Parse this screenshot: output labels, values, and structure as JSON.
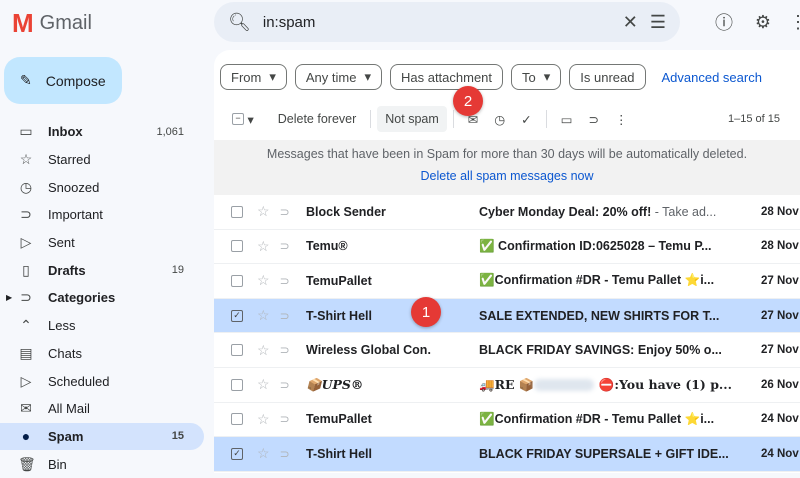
{
  "app": {
    "name": "Gmail",
    "logo_letter": "M"
  },
  "search": {
    "value": "in:spam"
  },
  "compose_label": "Compose",
  "sidebar": [
    {
      "label": "Inbox",
      "count": "1,061",
      "icon": "inbox-icon",
      "glyph": "▭",
      "bold": true
    },
    {
      "label": "Starred",
      "icon": "star-icon",
      "glyph": "☆"
    },
    {
      "label": "Snoozed",
      "icon": "clock-icon",
      "glyph": "◷"
    },
    {
      "label": "Important",
      "icon": "important-icon",
      "glyph": "⊃"
    },
    {
      "label": "Sent",
      "icon": "send-icon",
      "glyph": "▷"
    },
    {
      "label": "Drafts",
      "count": "19",
      "icon": "draft-icon",
      "glyph": "▯",
      "bold": true
    },
    {
      "label": "Categories",
      "icon": "label-icon",
      "glyph": "⊃",
      "bold": true
    },
    {
      "label": "Less",
      "icon": "chevron-up-icon",
      "glyph": "⌃"
    },
    {
      "label": "Chats",
      "icon": "chat-icon",
      "glyph": "▤"
    },
    {
      "label": "Scheduled",
      "icon": "scheduled-icon",
      "glyph": "▷"
    },
    {
      "label": "All Mail",
      "icon": "all-mail-icon",
      "glyph": "✉"
    },
    {
      "label": "Spam",
      "count": "15",
      "icon": "spam-icon",
      "glyph": "●",
      "active": true
    },
    {
      "label": "Bin",
      "icon": "trash-icon",
      "glyph": "🗑"
    }
  ],
  "filters": {
    "from": "From",
    "any_time": "Any time",
    "has_attachment": "Has attachment",
    "to": "To",
    "is_unread": "Is unread",
    "advanced": "Advanced search"
  },
  "toolbar": {
    "delete_forever": "Delete forever",
    "not_spam": "Not spam",
    "pagination": "1–15 of 15"
  },
  "banner": {
    "message": "Messages that have been in Spam for more than 30 days will be automatically deleted.",
    "link": "Delete all spam messages now"
  },
  "emails": [
    {
      "sender": "Block Sender",
      "subject": "Cyber Monday Deal: 20% off!",
      "snippet": " - Take ad...",
      "date": "28 Nov",
      "selected": false
    },
    {
      "sender": "Temu®",
      "subject": "✅ Confirmation ID:0625028 – Temu P...",
      "snippet": "",
      "date": "28 Nov",
      "selected": false
    },
    {
      "sender": "TemuPallet",
      "subject": "✅Confirmation #DR - Temu Pallet ⭐i...",
      "snippet": "",
      "date": "27 Nov",
      "selected": false
    },
    {
      "sender": "T-Shirt Hell",
      "subject": "SALE EXTENDED, NEW SHIRTS FOR T...",
      "snippet": "",
      "date": "27 Nov",
      "selected": true
    },
    {
      "sender": "Wireless Global Con.",
      "subject": "BLACK FRIDAY SAVINGS: Enjoy 50% o...",
      "snippet": "",
      "date": "27 Nov",
      "selected": false
    },
    {
      "sender": "📦UPS®",
      "subject": "🚚RE 📦",
      "subject_tail": "⛔:You have (1) p...",
      "snippet": "",
      "date": "26 Nov",
      "selected": false
    },
    {
      "sender": "TemuPallet",
      "subject": "✅Confirmation #DR - Temu Pallet ⭐i...",
      "snippet": "",
      "date": "24 Nov",
      "selected": false
    },
    {
      "sender": "T-Shirt Hell",
      "subject": "BLACK FRIDAY SUPERSALE + GIFT IDE...",
      "snippet": "",
      "date": "24 Nov",
      "selected": true
    }
  ],
  "annotations": {
    "badge1": "1",
    "badge2": "2"
  },
  "colors": {
    "accent": "#0b57d0",
    "compose": "#c2e7ff",
    "selected_row": "#c2dbff",
    "badge": "#e53935"
  }
}
